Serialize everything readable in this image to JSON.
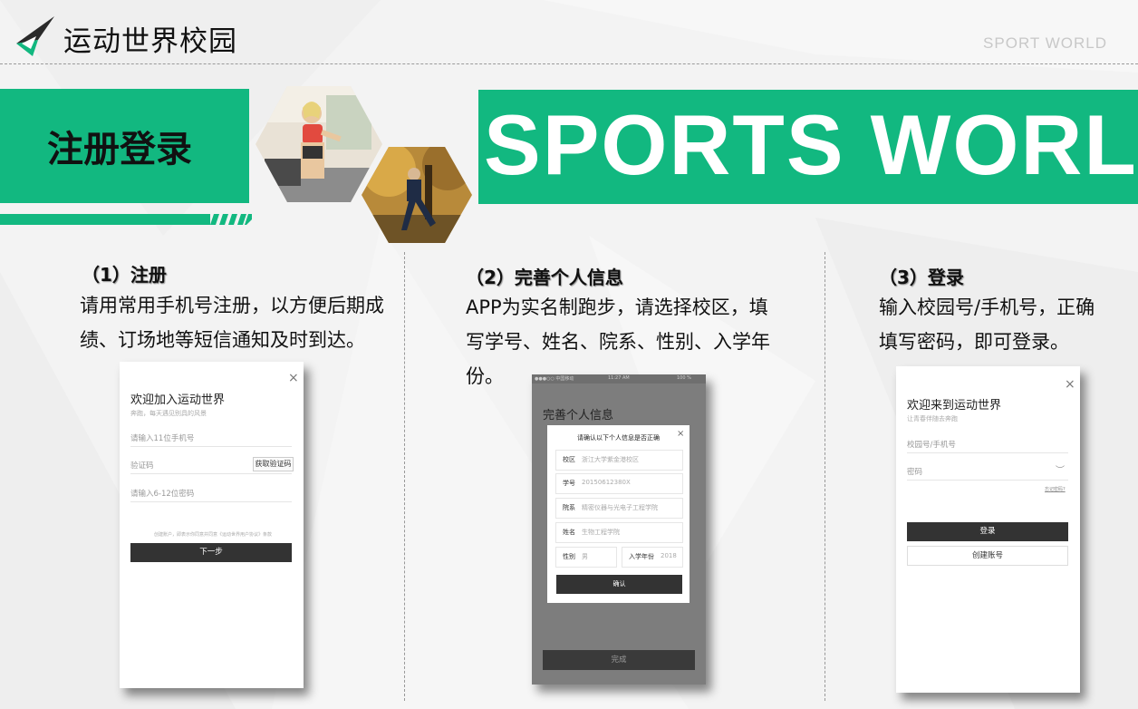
{
  "header": {
    "brand": "运动世界校园",
    "top_right": "SPORT WORLD"
  },
  "banner": {
    "section_title": "注册登录",
    "sports_text": "SPORTS WORLD"
  },
  "colors": {
    "accent": "#12b880",
    "dark_button": "#333333"
  },
  "columns": [
    {
      "heading": "（1）注册",
      "body": [
        "请用常用手机号注册，以方便后期成",
        "绩、订场地等短信通知及时到达。"
      ]
    },
    {
      "heading": "（2）完善个人信息",
      "body": [
        "APP为实名制跑步，请选择校区，填",
        "写学号、姓名、院系、性别、入学年",
        "份。"
      ]
    },
    {
      "heading": "（3）登录",
      "body": [
        "输入校园号/手机号，正确",
        "填写密码，即可登录。"
      ]
    }
  ],
  "register_screen": {
    "title": "欢迎加入运动世界",
    "subtitle": "奔跑，每天遇见别具的风景",
    "phone_placeholder": "请输入11位手机号",
    "code_placeholder": "验证码",
    "get_code": "获取验证码",
    "password_placeholder": "请输入6-12位密码",
    "agreement": "创建账户，即表示你同意并同意《运动世界用户协议》条款",
    "next": "下一步",
    "close": "×"
  },
  "info_screen": {
    "status_left": "●●●○○ 中国移动",
    "status_time": "11:27 AM",
    "status_right": "100 %",
    "page_title": "完善个人信息",
    "modal_title": "请确认以下个人信息是否正确",
    "close": "×",
    "rows": [
      {
        "key": "校区",
        "value": "浙江大学紫金港校区"
      },
      {
        "key": "学号",
        "value": "20150612380X"
      },
      {
        "key": "院系",
        "value": "精密仪器与光电子工程学院"
      },
      {
        "key": "姓名",
        "value": "生物工程学院"
      }
    ],
    "gender_key": "性别",
    "gender_value": "男",
    "year_key": "入学年份",
    "year_value": "2018",
    "confirm": "确认",
    "done": "完成"
  },
  "login_screen": {
    "title": "欢迎来到运动世界",
    "subtitle": "让青春伴随去奔跑",
    "account_placeholder": "校园号/手机号",
    "password_placeholder": "密码",
    "forgot": "忘记密码?",
    "login": "登录",
    "create": "创建账号",
    "close": "×"
  }
}
